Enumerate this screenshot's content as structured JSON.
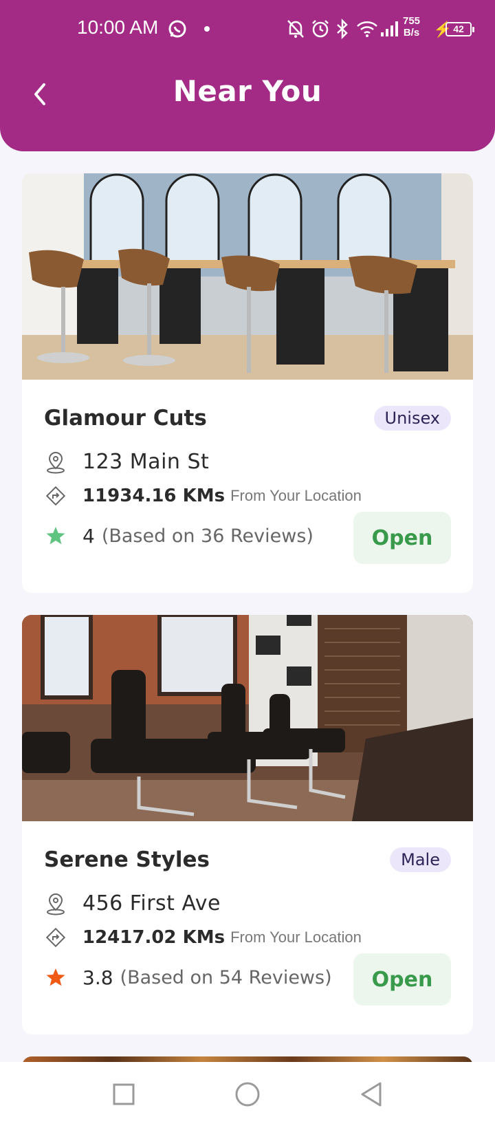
{
  "status_bar": {
    "time": "10:00 AM",
    "net_speed_value": "755",
    "net_speed_unit": "B/s",
    "battery": "42"
  },
  "header": {
    "title": "Near You"
  },
  "salons": [
    {
      "name": "Glamour Cuts",
      "category": "Unisex",
      "address": "123 Main St",
      "distance": "11934.16 KMs",
      "distance_suffix": "From Your Location",
      "rating": "4",
      "reviews_text": "(Based on 36 Reviews)",
      "star_color": "#5ec47f",
      "status": "Open"
    },
    {
      "name": "Serene Styles",
      "category": "Male",
      "address": "456 First Ave",
      "distance": "12417.02 KMs",
      "distance_suffix": "From Your Location",
      "rating": "3.8",
      "reviews_text": "(Based on 54 Reviews)",
      "star_color": "#f05a14",
      "status": "Open"
    }
  ],
  "colors": {
    "brand": "#a32b86",
    "open_bg": "#ecf6ec",
    "open_text": "#3a9a4c",
    "badge_bg": "#ece6fb"
  }
}
